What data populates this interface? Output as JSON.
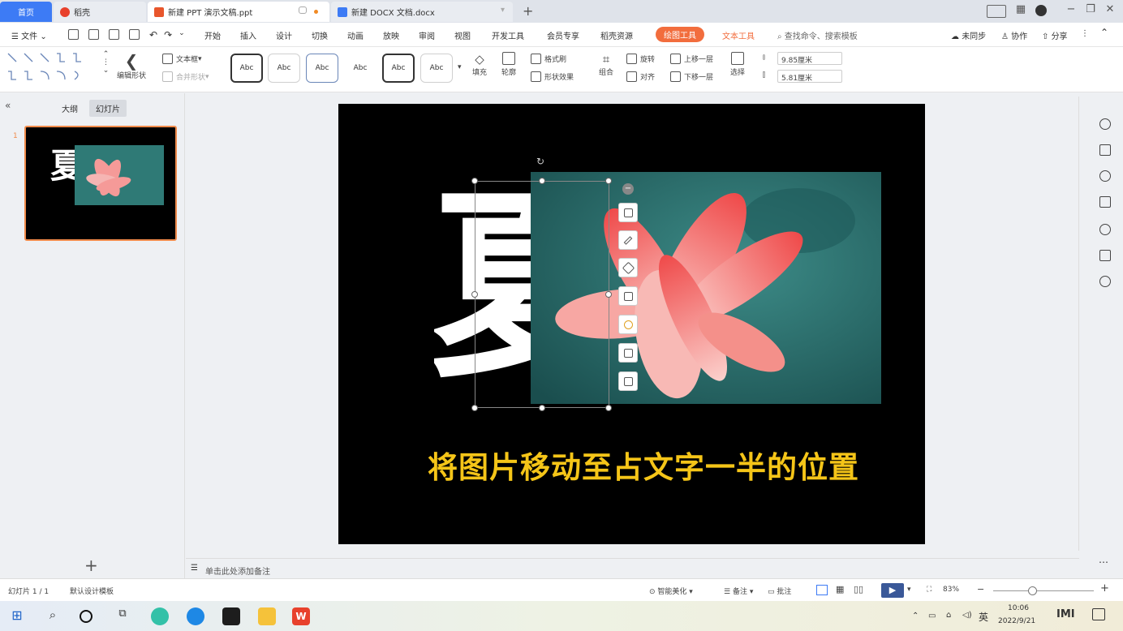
{
  "tabs": {
    "home": "首页",
    "dk": "稻壳",
    "ppt": "新建 PPT 演示文稿.ppt",
    "doc": "新建 DOCX 文档.docx",
    "add": "+"
  },
  "menu": {
    "file": "文件",
    "items": [
      "开始",
      "插入",
      "设计",
      "切换",
      "动画",
      "放映",
      "审阅",
      "视图",
      "开发工具",
      "会员专享",
      "稻壳资源"
    ],
    "picture_tools": "绘图工具",
    "text_tools": "文本工具",
    "search": "查找命令、搜索模板",
    "sync": "未同步",
    "collab": "协作",
    "share": "分享"
  },
  "ribbon": {
    "edit_shape": "编辑形状",
    "textbox": "文本框",
    "merge_shape": "合并形状",
    "style_label": "Abc",
    "fill": "填充",
    "outline": "轮廓",
    "format_painter": "格式刷",
    "shape_effect": "形状效果",
    "group": "组合",
    "rotate": "旋转",
    "align": "对齐",
    "bring_forward": "上移一层",
    "send_backward": "下移一层",
    "select": "选择",
    "height": "9.85厘米",
    "width": "5.81厘米"
  },
  "left_panel": {
    "outline_tab": "大纲",
    "slides_tab": "幻灯片",
    "slide_number": "1",
    "add": "+"
  },
  "slide": {
    "big_char": "夏",
    "caption": "将图片移动至占文字一半的位置",
    "caption_color": "#f5c518"
  },
  "notes": {
    "placeholder": "单击此处添加备注"
  },
  "status": {
    "slide_count": "幻灯片 1 / 1",
    "template": "默认设计模板",
    "beautify": "智能美化",
    "notes": "备注",
    "comments": "批注",
    "zoom": "83%"
  },
  "taskbar": {
    "time": "10:06",
    "date": "2022/9/21",
    "ime": "英"
  },
  "colors": {
    "accent": "#f26d3d",
    "home_tab": "#3d7bf5"
  }
}
